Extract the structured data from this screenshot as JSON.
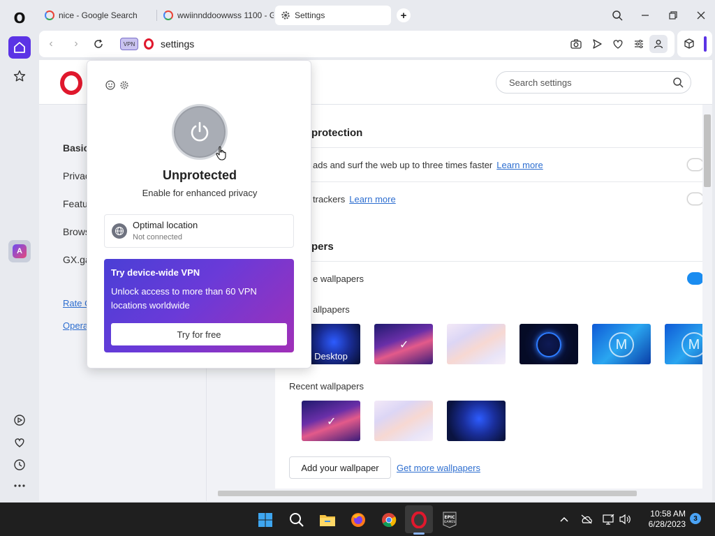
{
  "tabs": [
    {
      "label": "nice - Google Search",
      "icon": "google-icon"
    },
    {
      "label": "wwiinnddoowwss 1100 - G",
      "icon": "google-icon"
    },
    {
      "label": "Settings",
      "icon": "gear-icon"
    }
  ],
  "address_bar": {
    "vpn_badge": "VPN",
    "url": "settings"
  },
  "page": {
    "search_placeholder": "Search settings",
    "left_nav": {
      "items": [
        "Basic",
        "Privac",
        "Featu",
        "Brows",
        "GX.ga"
      ],
      "links": [
        "Rate O",
        "Opera"
      ]
    },
    "sections": {
      "protection": {
        "title": "protection",
        "row1_text": "ads and surf the web up to three times faster",
        "row1_link": "Learn more",
        "row2_text": "trackers",
        "row2_link": "Learn more"
      },
      "wallpapers": {
        "title": "pers",
        "enable_label": "e wallpapers",
        "enabled": true,
        "builtin_label": "allpapers",
        "desktop_label": "Desktop",
        "recent_label": "Recent wallpapers",
        "add_button": "Add your wallpaper",
        "more_link": "Get more wallpapers"
      }
    }
  },
  "vpn_popup": {
    "status": "Unprotected",
    "subtitle": "Enable for enhanced privacy",
    "location_title": "Optimal location",
    "location_status": "Not connected",
    "promo_title": "Try device-wide VPN",
    "promo_text": "Unlock access to more than 60 VPN locations worldwide",
    "promo_button": "Try for free"
  },
  "taskbar": {
    "time": "10:58 AM",
    "date": "6/28/2023",
    "notification_count": "3",
    "epic_label": "EPIC GAMES"
  },
  "colors": {
    "opera_red": "#e0182d",
    "accent_purple": "#5b33e5",
    "toggle_blue": "#1a8cf0"
  }
}
